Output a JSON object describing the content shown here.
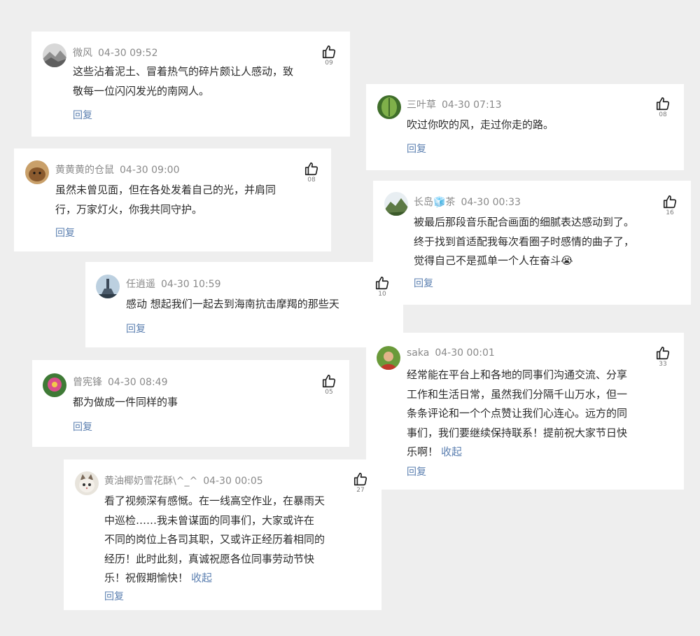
{
  "comments": [
    {
      "user": "微风",
      "time": "04-30 09:52",
      "lines": [
        "这些沾着泥土、冒着热气的碎片颇让人感动，致",
        "敬每一位闪闪发光的南网人。"
      ],
      "likes": "09",
      "reply_label": "回复",
      "avatar_icon": "landscape-avatar-icon"
    },
    {
      "user": "三叶草",
      "time": "04-30 07:13",
      "lines": [
        "吹过你吹的风，走过你走的路。"
      ],
      "likes": "08",
      "reply_label": "回复",
      "avatar_icon": "leaf-avatar-icon"
    },
    {
      "user": "黄黄黄的仓鼠",
      "time": "04-30 09:00",
      "lines": [
        "虽然未曾见面，但在各处发着自己的光，并肩同",
        "行，万家灯火，你我共同守护。"
      ],
      "likes": "08",
      "reply_label": "回复",
      "avatar_icon": "hamster-avatar-icon"
    },
    {
      "user": "长岛🧊茶",
      "time": "04-30 00:33",
      "lines": [
        "被最后那段音乐配合画面的细腻表达感动到了。",
        "终于找到首适配我每次看圈子时感情的曲子了，",
        "觉得自己不是孤单一个人在奋斗😭"
      ],
      "likes": "16",
      "reply_label": "回复",
      "avatar_icon": "hill-avatar-icon"
    },
    {
      "user": "任逍遥",
      "time": "04-30 10:59",
      "lines": [
        "感动 想起我们一起去到海南抗击摩羯的那些天"
      ],
      "likes": "10",
      "reply_label": "回复",
      "avatar_icon": "tower-avatar-icon"
    },
    {
      "user": "saka",
      "time": "04-30 00:01",
      "lines": [
        "经常能在平台上和各地的同事们沟通交流、分享",
        "工作和生活日常，虽然我们分隔千山万水，但一",
        "条条评论和一个个点赞让我们心连心。远方的同",
        "事们，我们要继续保持联系！提前祝大家节日快",
        "乐啊！"
      ],
      "collapse_label": "收起",
      "likes": "33",
      "reply_label": "回复",
      "avatar_icon": "person-avatar-icon"
    },
    {
      "user": "曾宪锋",
      "time": "04-30 08:49",
      "lines": [
        "都为做成一件同样的事"
      ],
      "likes": "05",
      "reply_label": "回复",
      "avatar_icon": "flower-avatar-icon"
    },
    {
      "user": "黄油椰奶雪花酥\\^_^",
      "time": "04-30 00:05",
      "lines": [
        "看了视频深有感慨。在一线高空作业，在暴雨天",
        "中巡检……我未曾谋面的同事们，大家或许在",
        "不同的岗位上各司其职，又或许正经历着相同的",
        "经历！此时此刻，真诚祝愿各位同事劳动节快",
        "乐！祝假期愉快！"
      ],
      "collapse_label": "收起",
      "likes": "27",
      "reply_label": "回复",
      "avatar_icon": "cat-avatar-icon"
    }
  ]
}
